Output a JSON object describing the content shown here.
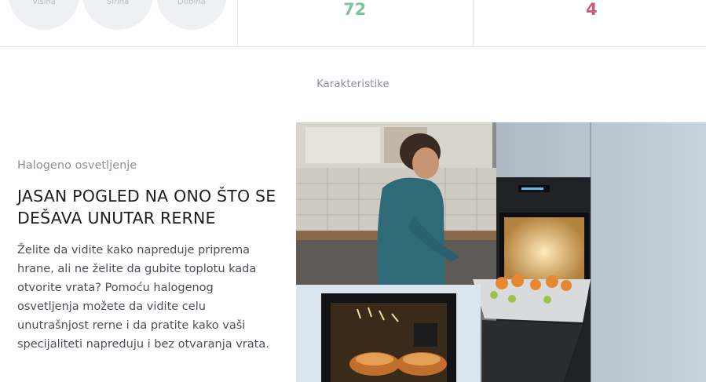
{
  "dimensions": {
    "labels": [
      "Visina",
      "Širina",
      "Dubina"
    ]
  },
  "stats": [
    {
      "value": "72",
      "color": "#7cc49b"
    },
    {
      "value": "4",
      "color": "#c95a78"
    }
  ],
  "section": {
    "title": "Karakteristike"
  },
  "feature": {
    "eyebrow": "Halogeno osvetljenje",
    "headline": "JASAN POGLED NA ONO ŠTO SE DEŠAVA UNUTAR RERNE",
    "body": "Želite da vidite kako napreduje priprema hrane, ali ne želite da gubite toplotu kada otvorite vrata? Pomoću halogenog osvetljenja možete da vidite celu unutrašnjost rerne i da pratite kako vaši specijaliteti napreduju i bez otvaranja vrata."
  }
}
